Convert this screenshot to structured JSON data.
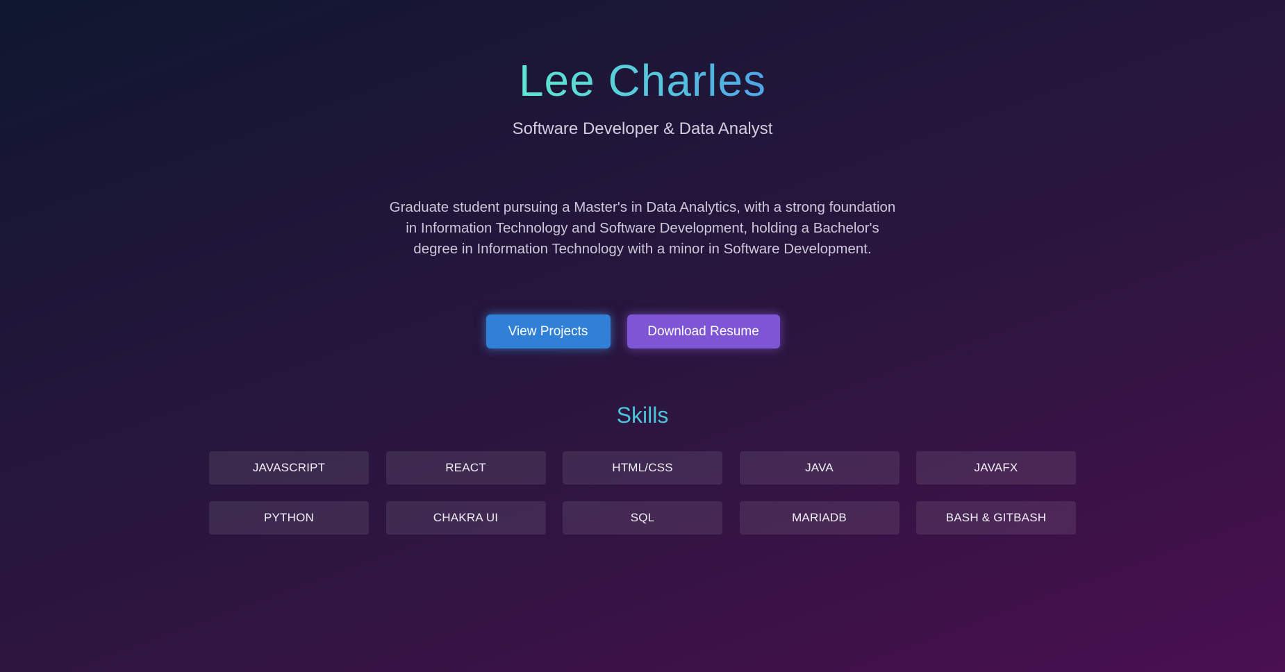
{
  "hero": {
    "name": "Lee Charles",
    "subtitle": "Software Developer & Data Analyst",
    "bio": "Graduate student pursuing a Master's in Data Analytics, with a strong foundation in Information Technology and Software Development, holding a Bachelor's degree in Information Technology with a minor in Software Development."
  },
  "buttons": {
    "view_projects": "View Projects",
    "download_resume": "Download Resume"
  },
  "skills": {
    "title": "Skills",
    "items": [
      "JAVASCRIPT",
      "REACT",
      "HTML/CSS",
      "JAVA",
      "JAVAFX",
      "PYTHON",
      "CHAKRA UI",
      "SQL",
      "MARIADB",
      "BASH & GITBASH"
    ]
  },
  "colors": {
    "name_gradient_start": "#5ee8d2",
    "name_gradient_end": "#4fa4e6",
    "primary_button": "#2f80d6",
    "secondary_button": "#7e55d4",
    "skills_heading": "#4cc3d8"
  }
}
